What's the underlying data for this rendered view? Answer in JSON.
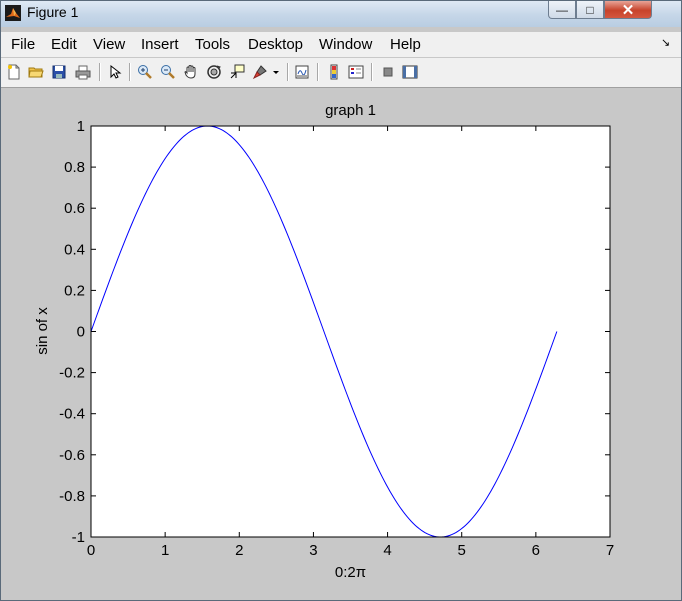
{
  "window": {
    "title": "Figure 1"
  },
  "menu": [
    "File",
    "Edit",
    "View",
    "Insert",
    "Tools",
    "Desktop",
    "Window",
    "Help"
  ],
  "toolbar": {
    "icons": [
      "new-file-icon",
      "open-folder-icon",
      "save-icon",
      "print-icon",
      "pointer-icon",
      "zoom-in-icon",
      "zoom-out-icon",
      "pan-hand-icon",
      "rotate-3d-icon",
      "data-cursor-icon",
      "brush-icon",
      "brush-dropdown-icon",
      "link-plot-icon",
      "colorbar-icon",
      "legend-icon",
      "hide-plot-tools-icon",
      "show-plot-tools-icon"
    ]
  },
  "chart_data": {
    "type": "line",
    "title": "graph 1",
    "xlabel": "0:2π",
    "ylabel": "sin of x",
    "xlim": [
      0,
      7
    ],
    "ylim": [
      -1,
      1
    ],
    "x_ticks": [
      "0",
      "1",
      "2",
      "3",
      "4",
      "5",
      "6",
      "7"
    ],
    "y_ticks": [
      "1",
      "0.8",
      "0.6",
      "0.4",
      "0.2",
      "0",
      "-0.2",
      "-0.4",
      "-0.6",
      "-0.8",
      "-1"
    ],
    "series": [
      {
        "color": "#0000ff",
        "x": [
          0,
          0.3142,
          0.6283,
          0.9425,
          1.2566,
          1.5708,
          1.885,
          2.1991,
          2.5133,
          2.8274,
          3.1416,
          3.4558,
          3.7699,
          4.0841,
          4.3982,
          4.7124,
          5.0265,
          5.3407,
          5.6549,
          5.969,
          6.2832
        ],
        "y": [
          0,
          0.309,
          0.588,
          0.809,
          0.951,
          1,
          0.951,
          0.809,
          0.588,
          0.309,
          0,
          -0.309,
          -0.588,
          -0.809,
          -0.951,
          -1,
          -0.951,
          -0.809,
          -0.588,
          -0.309,
          0
        ]
      }
    ]
  }
}
